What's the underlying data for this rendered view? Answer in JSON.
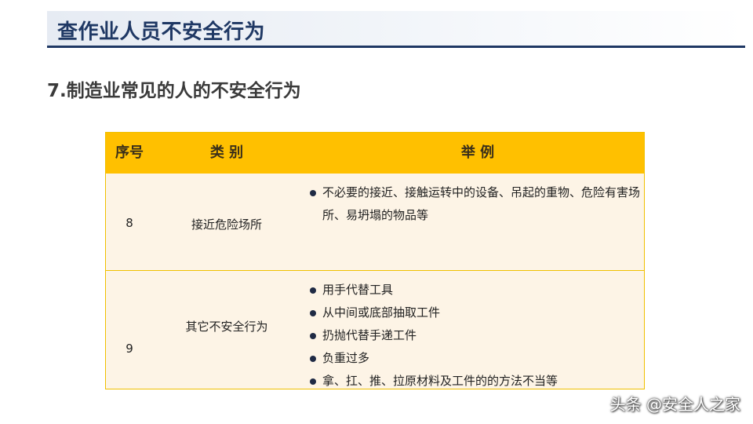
{
  "header": {
    "title": "查作业人员不安全行为"
  },
  "section": {
    "subtitle": "7.制造业常见的人的不安全行为"
  },
  "table": {
    "columns": [
      "序号",
      "类 别",
      "举 例"
    ],
    "rows": [
      {
        "seq": "8",
        "category": "接近危险场所",
        "examples": [
          "不必要的接近、接触运转中的设备、吊起的重物、危险有害场所、易坍塌的物品等"
        ]
      },
      {
        "seq": "9",
        "category": "其它不安全行为",
        "examples": [
          "用手代替工具",
          "从中间或底部抽取工件",
          "扔抛代替手递工件",
          "负重过多",
          "拿、扛、推、拉原材料及工件的的方法不当等"
        ]
      }
    ]
  },
  "watermark": {
    "text": "头条 @安全人之家"
  },
  "colors": {
    "title": "#1f3864",
    "header_fill": "#ffc000",
    "row_fill": "#fdf4e6",
    "border": "#f0c000"
  }
}
